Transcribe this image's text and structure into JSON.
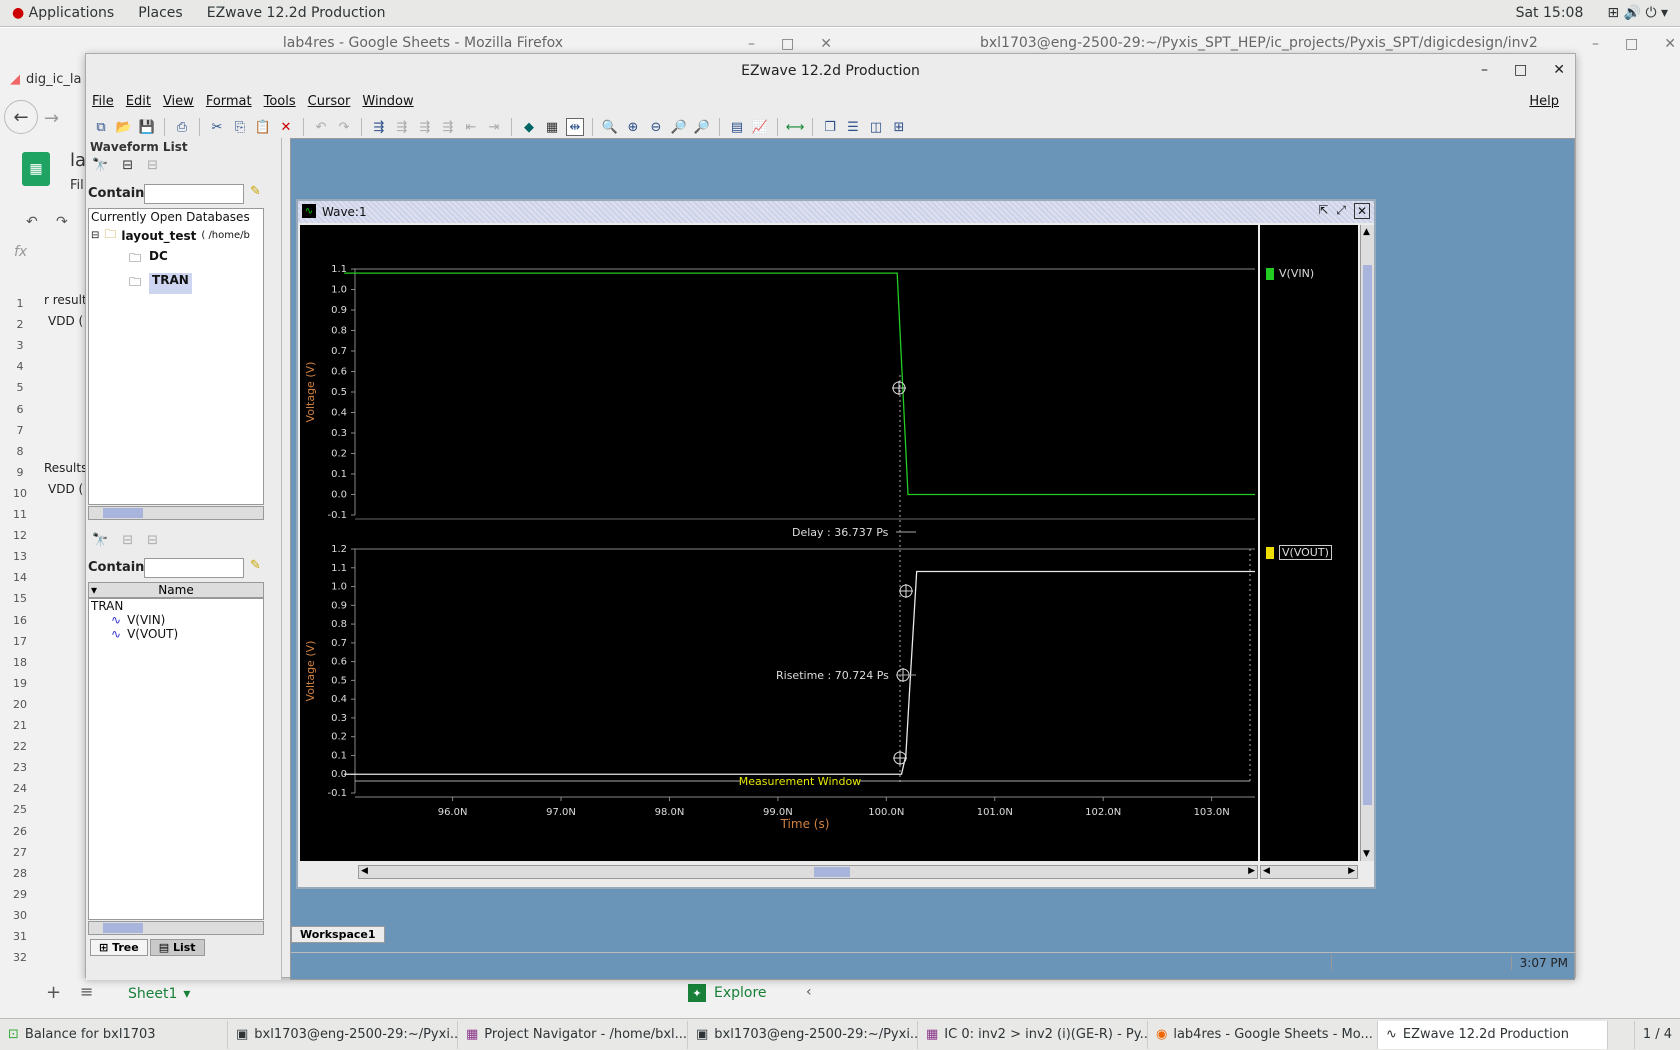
{
  "topbar": {
    "applications": "Applications",
    "places": "Places",
    "app_name": "EZwave 12.2d Production",
    "clock": "Sat 15:08"
  },
  "bg_windows": {
    "firefox_title": "lab4res - Google Sheets - Mozilla Firefox",
    "terminal_title": "bxl1703@eng-2500-29:~/Pyxis_SPT_HEP/ic_projects/Pyxis_SPT/digicdesign/inv2",
    "tab_text": "dig_ic_la",
    "sheet_text_a": "la",
    "sheet_text_b": "Fil",
    "formula_fx": "fx",
    "rows": [
      "1",
      "2",
      "3",
      "4",
      "5",
      "6",
      "7",
      "8",
      "9",
      "10",
      "11",
      "12",
      "13",
      "14",
      "15",
      "16",
      "17",
      "18",
      "19",
      "20",
      "21",
      "22",
      "23",
      "24",
      "25",
      "26",
      "27",
      "28",
      "29",
      "30",
      "31",
      "32"
    ],
    "row_texts": {
      "r1": "r result",
      "r2": "VDD (",
      "r9": "Results",
      "r10": "VDD ("
    },
    "sheet_tab": "Sheet1",
    "explore": "Explore"
  },
  "ezwave": {
    "title": "EZwave 12.2d Production",
    "menus": [
      "File",
      "Edit",
      "View",
      "Format",
      "Tools",
      "Cursor",
      "Window"
    ],
    "help": "Help",
    "waveform_list": {
      "header": "Waveform List",
      "contains_label": "Contains",
      "currently_open": "Currently Open Databases",
      "db_name": "layout_test",
      "db_path": "( /home/b",
      "folders": [
        "DC",
        "TRAN"
      ],
      "name_header": "Name",
      "list_root": "TRAN",
      "signals": [
        "V(VIN)",
        "V(VOUT)"
      ],
      "tab_tree": "Tree",
      "tab_list": "List"
    },
    "wave_window": {
      "title": "Wave:1"
    },
    "workspace_tab": "Workspace1",
    "status_time": "3:07 PM"
  },
  "chart_data": [
    {
      "type": "line",
      "series": [
        {
          "name": "V(VIN)",
          "color": "#22cc22",
          "x": [
            95.0,
            100.1,
            100.2,
            103.4
          ],
          "y": [
            1.08,
            1.08,
            0.0,
            0.0
          ]
        }
      ],
      "ylabel": "Voltage (V)",
      "ylim": [
        -0.1,
        1.1
      ],
      "yticks": [
        "1.1",
        "1.0",
        "0.9",
        "0.8",
        "0.7",
        "0.6",
        "0.5",
        "0.4",
        "0.3",
        "0.2",
        "0.1",
        "0.0",
        "-0.1"
      ],
      "xlim": [
        95.1,
        103.4
      ],
      "annotation": "Delay : 36.737 Ps"
    },
    {
      "type": "line",
      "series": [
        {
          "name": "V(VOUT)",
          "color": "#e8e8e8",
          "x": [
            95.0,
            100.14,
            100.18,
            100.22,
            100.28,
            103.4
          ],
          "y": [
            0.0,
            0.0,
            0.1,
            0.5,
            1.08,
            1.08
          ]
        }
      ],
      "ylabel": "Voltage (V)",
      "xlabel": "Time (s)",
      "ylim": [
        -0.1,
        1.2
      ],
      "yticks": [
        "1.2",
        "1.1",
        "1.0",
        "0.9",
        "0.8",
        "0.7",
        "0.6",
        "0.5",
        "0.4",
        "0.3",
        "0.2",
        "0.1",
        "0.0",
        "-0.1"
      ],
      "xlim": [
        95.1,
        103.4
      ],
      "xticks": [
        "96.0N",
        "97.0N",
        "98.0N",
        "99.0N",
        "100.0N",
        "101.0N",
        "102.0N",
        "103.0N"
      ],
      "annotations": [
        "Risetime : 70.724 Ps",
        "Measurement Window"
      ]
    }
  ],
  "taskbar": {
    "items": [
      "Balance for bxl1703",
      "bxl1703@eng-2500-29:~/Pyxi...",
      "Project Navigator - /home/bxl...",
      "bxl1703@eng-2500-29:~/Pyxi...",
      "IC 0: inv2 > inv2 (i)(GE-R)  - Py...",
      "lab4res - Google Sheets - Mo...",
      "EZwave 12.2d Production"
    ],
    "pager": "1 / 4"
  }
}
